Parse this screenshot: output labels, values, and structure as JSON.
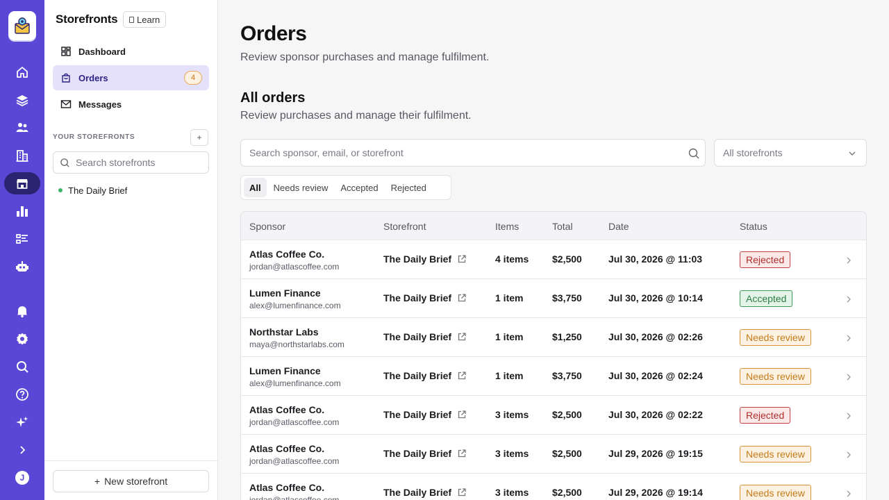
{
  "rail": {
    "items": [
      "home-icon",
      "layers-icon",
      "audience-icon",
      "building-icon",
      "storefront-icon",
      "bar-chart-icon",
      "checklist-icon",
      "bot-icon",
      "bell-icon",
      "settings-icon",
      "search-icon",
      "help-icon",
      "sparkle-icon",
      "expand-icon"
    ],
    "active": "storefront-icon",
    "avatar_initial": "J"
  },
  "sidebar": {
    "title": "Storefronts",
    "learn_label": "Learn",
    "nav": [
      {
        "label": "Dashboard",
        "icon": "dashboard-icon"
      },
      {
        "label": "Orders",
        "icon": "bag-icon",
        "badge": "4",
        "active": true
      },
      {
        "label": "Messages",
        "icon": "mail-icon"
      }
    ],
    "section_label": "YOUR STOREFRONTS",
    "add_label": "+",
    "search_placeholder": "Search storefronts",
    "storefronts": [
      {
        "name": "The Daily Brief",
        "status": "active"
      }
    ],
    "new_storefront_label": "New storefront"
  },
  "main": {
    "title": "Orders",
    "subtitle": "Review sponsor purchases and manage fulfilment.",
    "section_title": "All orders",
    "section_subtitle": "Review purchases and manage their fulfilment.",
    "search_placeholder": "Search sponsor, email, or storefront",
    "filter_value": "All storefronts",
    "tabs": [
      "All",
      "Needs review",
      "Accepted",
      "Rejected"
    ],
    "active_tab": "All"
  },
  "table": {
    "columns": [
      "Sponsor",
      "Storefront",
      "Items",
      "Total",
      "Date",
      "Status"
    ],
    "rows": [
      {
        "sponsor": "Atlas Coffee Co.",
        "email": "jordan@atlascoffee.com",
        "storefront": "The Daily Brief",
        "items": "4 items",
        "total": "$2,500",
        "date": "Jul 30, 2026 @ 11:03",
        "status": "Rejected",
        "status_kind": "rejected"
      },
      {
        "sponsor": "Lumen Finance",
        "email": "alex@lumenfinance.com",
        "storefront": "The Daily Brief",
        "items": "1 item",
        "total": "$3,750",
        "date": "Jul 30, 2026 @ 10:14",
        "status": "Accepted",
        "status_kind": "accepted"
      },
      {
        "sponsor": "Northstar Labs",
        "email": "maya@northstarlabs.com",
        "storefront": "The Daily Brief",
        "items": "1 item",
        "total": "$1,250",
        "date": "Jul 30, 2026 @ 02:26",
        "status": "Needs review",
        "status_kind": "review"
      },
      {
        "sponsor": "Lumen Finance",
        "email": "alex@lumenfinance.com",
        "storefront": "The Daily Brief",
        "items": "1 item",
        "total": "$3,750",
        "date": "Jul 30, 2026 @ 02:24",
        "status": "Needs review",
        "status_kind": "review"
      },
      {
        "sponsor": "Atlas Coffee Co.",
        "email": "jordan@atlascoffee.com",
        "storefront": "The Daily Brief",
        "items": "3 items",
        "total": "$2,500",
        "date": "Jul 30, 2026 @ 02:22",
        "status": "Rejected",
        "status_kind": "rejected"
      },
      {
        "sponsor": "Atlas Coffee Co.",
        "email": "jordan@atlascoffee.com",
        "storefront": "The Daily Brief",
        "items": "3 items",
        "total": "$2,500",
        "date": "Jul 29, 2026 @ 19:15",
        "status": "Needs review",
        "status_kind": "review"
      },
      {
        "sponsor": "Atlas Coffee Co.",
        "email": "jordan@atlascoffee.com",
        "storefront": "The Daily Brief",
        "items": "3 items",
        "total": "$2,500",
        "date": "Jul 29, 2026 @ 19:14",
        "status": "Needs review",
        "status_kind": "review"
      }
    ]
  },
  "colors": {
    "rail": "#5b47d6",
    "rail_active": "#2a2370",
    "nav_active_bg": "#e5e1fb",
    "rejected": "#b0302d",
    "accepted": "#2b7d44",
    "review": "#c47a1a"
  }
}
